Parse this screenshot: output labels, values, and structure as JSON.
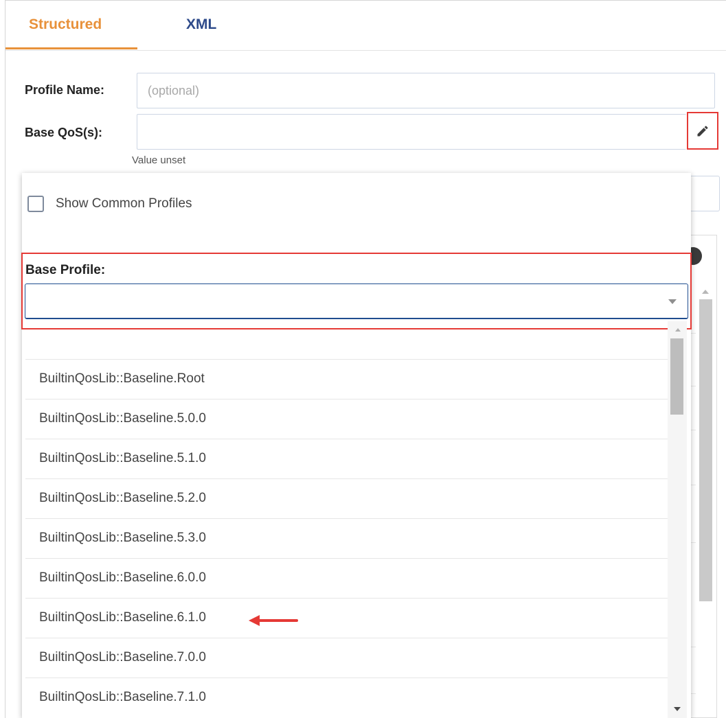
{
  "tabs": {
    "structured": "Structured",
    "xml": "XML",
    "active": "Structured"
  },
  "form": {
    "profile_name_label": "Profile Name:",
    "profile_name_placeholder": "(optional)",
    "profile_name_value": "",
    "base_qos_label": "Base QoS(s):",
    "base_qos_value": "",
    "base_qos_hint": "Value unset",
    "edit_icon": "pencil-icon"
  },
  "popup": {
    "show_common_profiles_label": "Show Common Profiles",
    "show_common_profiles_checked": false,
    "base_profile_label": "Base Profile:",
    "base_profile_value": "",
    "options": [
      "",
      "BuiltinQosLib::Baseline.Root",
      "BuiltinQosLib::Baseline.5.0.0",
      "BuiltinQosLib::Baseline.5.1.0",
      "BuiltinQosLib::Baseline.5.2.0",
      "BuiltinQosLib::Baseline.5.3.0",
      "BuiltinQosLib::Baseline.6.0.0",
      "BuiltinQosLib::Baseline.6.1.0",
      "BuiltinQosLib::Baseline.7.0.0",
      "BuiltinQosLib::Baseline.7.1.0"
    ]
  },
  "colors": {
    "tab_active": "#e8913a",
    "tab_inactive": "#2d4a8a",
    "highlight": "#e53935",
    "select_border": "#1f4d8f"
  }
}
